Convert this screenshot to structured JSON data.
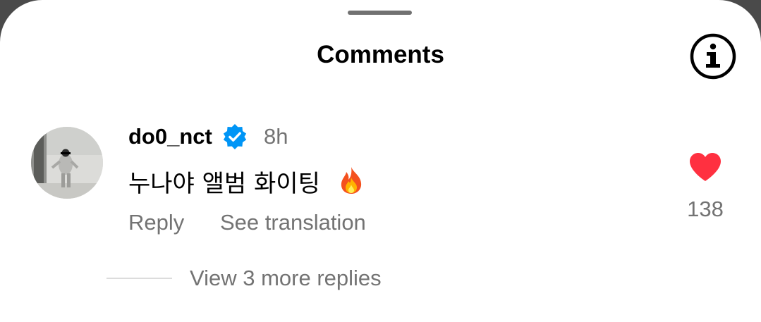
{
  "header": {
    "title": "Comments",
    "info_icon": "info-icon"
  },
  "comment": {
    "username": "do0_nct",
    "verified": true,
    "time": "8h",
    "text": "누나야 앨범 화이팅",
    "emoji_icon": "fire-emoji",
    "reply_label": "Reply",
    "translate_label": "See translation",
    "like_count": "138",
    "liked": true,
    "view_replies_label": "View 3 more replies"
  },
  "colors": {
    "verified_blue": "#0095f6",
    "like_red": "#ff3040",
    "secondary_text": "#737373"
  }
}
